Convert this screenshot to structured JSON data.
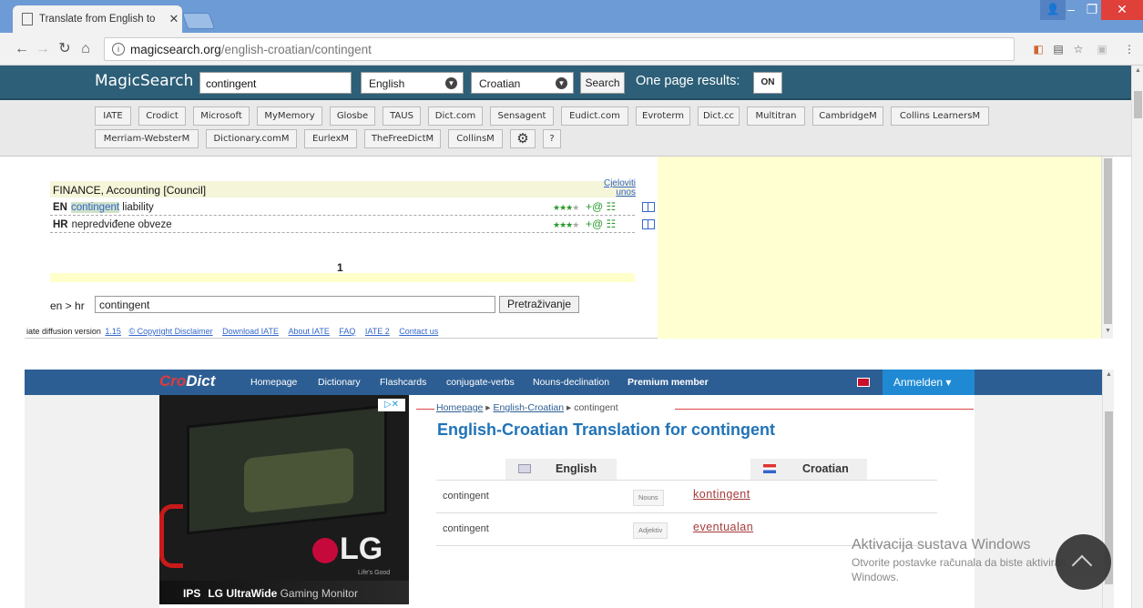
{
  "browser": {
    "tab_title": "Translate from English to",
    "url_domain": "magicsearch.org",
    "url_path": "/english-croatian/contingent"
  },
  "magicsearch": {
    "logo": "MagicSearch",
    "query": "contingent",
    "source_lang": "English",
    "target_lang": "Croatian",
    "search_label": "Search",
    "one_page_label": "One page results:",
    "toggle_label": "ON",
    "dictionaries_row1": [
      "IATE",
      "Crodict",
      "Microsoft",
      "MyMemory",
      "Glosbe",
      "TAUS",
      "Dict.com",
      "Sensagent",
      "Eudict.com",
      "Evroterm",
      "Dict.cc",
      "Multitran",
      "CambridgeM",
      "Collins LearnersM"
    ],
    "dictionaries_row2": [
      "Merriam-WebsterM",
      "Dictionary.comM",
      "EurlexM",
      "TheFreeDictM",
      "CollinsM",
      "?"
    ]
  },
  "iate": {
    "domain_heading": "FINANCE, Accounting [Council]",
    "full_entry_link_1": "Cjeloviti",
    "full_entry_link_2": "unos",
    "en_code": "EN",
    "en_highlight": "contingent",
    "en_rest": " liability",
    "hr_code": "HR",
    "hr_term": "nepredviđene obveze",
    "stars_filled": "★★★",
    "stars_empty": "★",
    "row_icons": "+@ ☷",
    "page_number": "1",
    "direction": "en > hr",
    "query": "contingent",
    "search_button": "Pretraživanje",
    "footer_prefix": "iate diffusion version",
    "footer_version": "1.15",
    "footer_copyright": "© Copyright Disclaimer",
    "footer_links": [
      "Download IATE",
      "About IATE",
      "FAQ",
      "IATE 2",
      "Contact us"
    ]
  },
  "crodict": {
    "logo_a": "Cro",
    "logo_b": "Dict",
    "nav": [
      "Homepage",
      "Dictionary",
      "Flashcards",
      "conjugate-verbs",
      "Nouns-declination",
      "Premium member"
    ],
    "login_label": "Anmelden",
    "ad_badge": "▷✕",
    "ad_brand": "LG",
    "ad_slogan": "Life's Good",
    "ad_ips": "IPS",
    "ad_ultrawide": "LG UltraWide",
    "ad_gaming": " Gaming Monitor",
    "breadcrumb_home": "Homepage",
    "breadcrumb_pair": "English-Croatian",
    "breadcrumb_current": "contingent",
    "page_title": "English-Croatian Translation for contingent",
    "col_en": "English",
    "col_hr": "Croatian",
    "rows": [
      {
        "en": "contingent",
        "pos": "Nouns",
        "hr": "kontingent"
      },
      {
        "en": "contingent",
        "pos": "Adjektiv",
        "hr": "eventualan"
      }
    ]
  },
  "watermark": {
    "line1": "Aktivacija sustava Windows",
    "line2": "Otvorite postavke računala da biste aktivirali",
    "line3": "Windows."
  }
}
